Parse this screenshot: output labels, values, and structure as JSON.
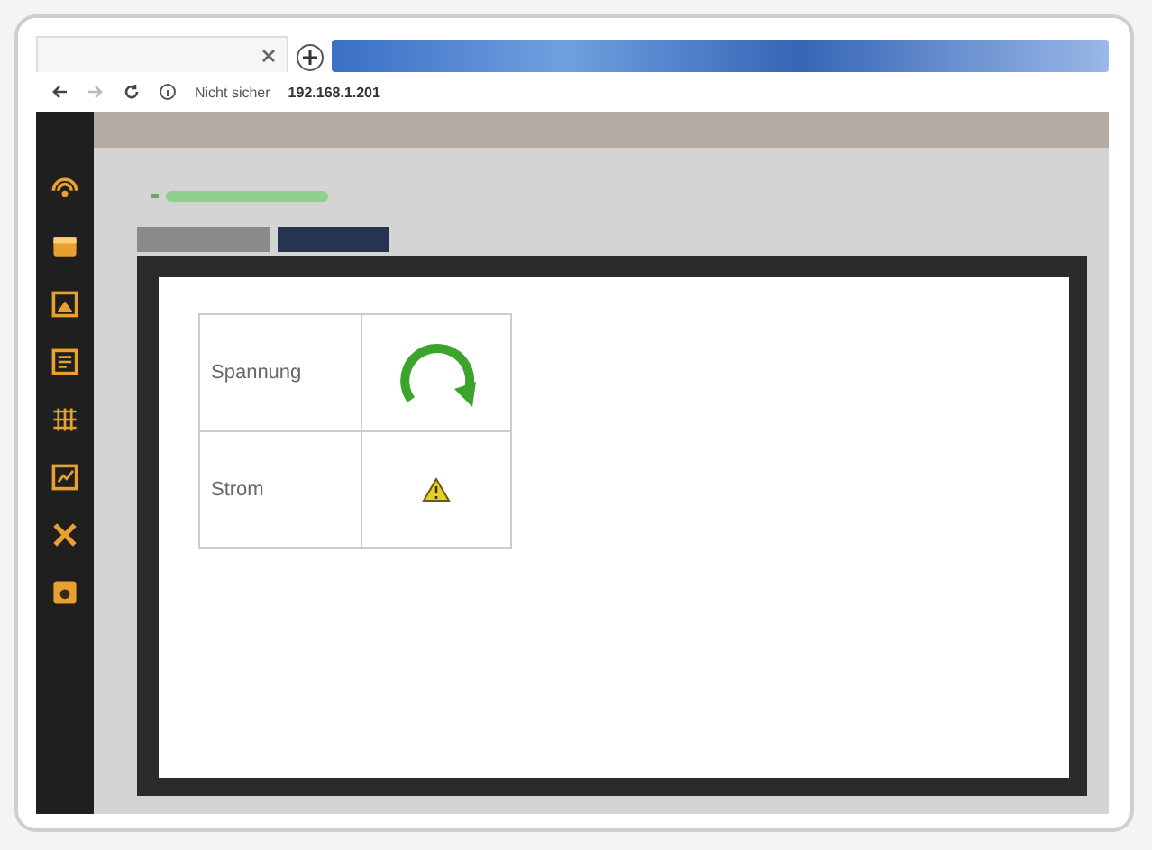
{
  "address_bar": {
    "security": "Nicht sicher",
    "host": "192.168.1.201"
  },
  "tabs": [
    {
      "selected": false
    },
    {
      "selected": true
    }
  ],
  "table": {
    "rows": [
      {
        "label": "Spannung",
        "kind": "refresh"
      },
      {
        "label": "Strom",
        "kind": "warning"
      }
    ]
  }
}
